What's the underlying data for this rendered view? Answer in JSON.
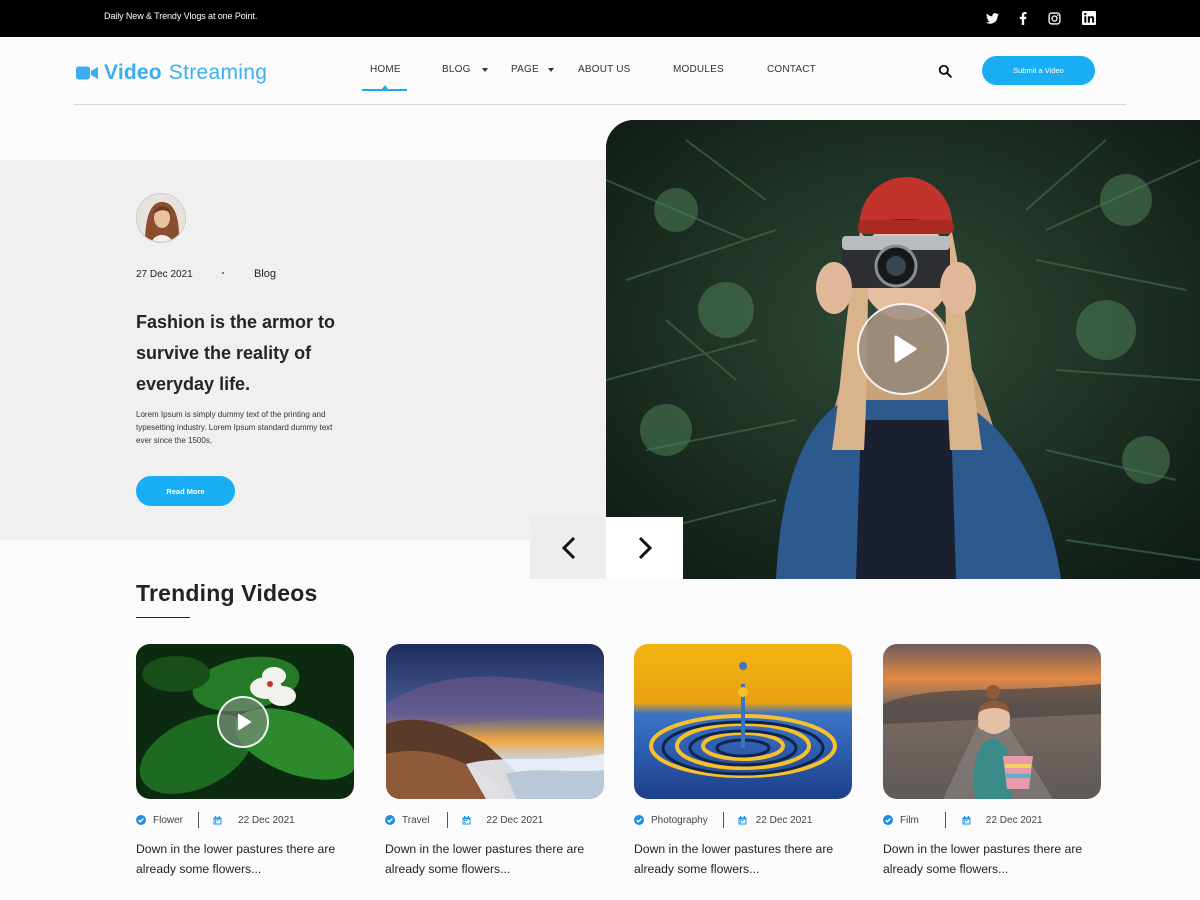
{
  "topbar": {
    "tagline": "Daily New & Trendy Vlogs at one Point.",
    "social": [
      "twitter-icon",
      "facebook-icon",
      "instagram-icon",
      "linkedin-icon"
    ]
  },
  "logo": {
    "word1": "Video",
    "word2": "Streaming",
    "color": "#3aaef0"
  },
  "nav": {
    "items": [
      {
        "label": "HOME",
        "active": true
      },
      {
        "label": "BLOG",
        "dropdown": true
      },
      {
        "label": "PAGE",
        "dropdown": true
      },
      {
        "label": "ABOUT US"
      },
      {
        "label": "MODULES"
      },
      {
        "label": "CONTACT"
      }
    ],
    "search_icon": "search-icon",
    "submit_label": "Submit a Video"
  },
  "hero": {
    "date": "27 Dec 2021",
    "category": "Blog",
    "title": "Fashion is the armor to survive the reality of everyday life.",
    "text": "Lorem Ipsum is simply dummy text of the printing and typesetting industry. Lorem Ipsum standard dummy text ever since the 1500s,",
    "button": "Read More"
  },
  "trending": {
    "heading": "Trending Videos",
    "cards": [
      {
        "category": "Flower",
        "date": "22 Dec 2021",
        "title": "Down in the lower pastures there are already some flowers..."
      },
      {
        "category": "Travel",
        "date": "22 Dec 2021",
        "title": "Down in the lower pastures there are already some flowers..."
      },
      {
        "category": "Photography",
        "date": "22 Dec 2021",
        "title": "Down in the lower pastures there are already some flowers..."
      },
      {
        "category": "Film",
        "date": "22 Dec 2021",
        "title": "Down in the lower pastures there are already some flowers..."
      }
    ]
  },
  "colors": {
    "accent": "#19adf3",
    "topbar": "#000000",
    "text": "#222222"
  }
}
